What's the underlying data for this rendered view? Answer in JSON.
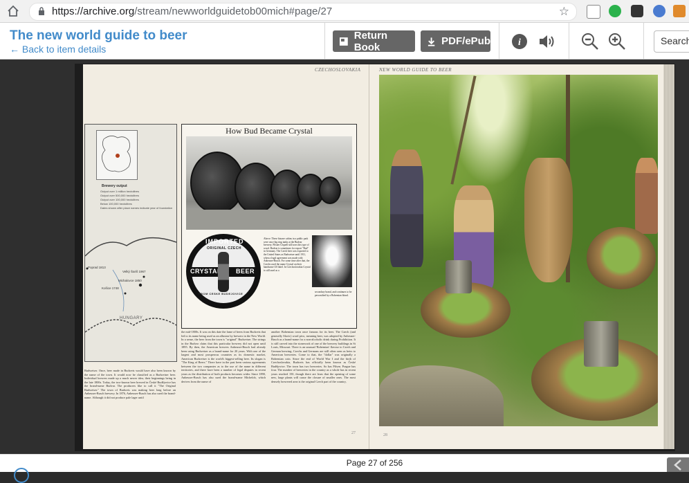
{
  "browser": {
    "url_host": "https://archive.org",
    "url_path": "/stream/newworldguidetob00mich#page/27"
  },
  "header": {
    "title": "The new world guide to beer",
    "back_link": "← Back to item details",
    "return_book": "Return Book",
    "pdf_epub": "PDF/ePub",
    "search_placeholder": "Search"
  },
  "book": {
    "left_running_head": "CZECHOSLOVAKIA",
    "right_running_head": "NEW WORLD GUIDE TO BEER",
    "feature_title": "How Bud Became Crystal",
    "label_top": "IMPORTED",
    "label_original": "ORIGINAL CZECH",
    "label_crystal": "CRYSTAL",
    "label_beer": "BEER",
    "label_bottom": "FROM CESKE BUDEJOVICE",
    "map_legend_title": "Brewery output",
    "map_legend": [
      "Output over 1 million hectolitres",
      "Output over 500,000 hectolitres",
      "Output over 100,000 hectolitres",
      "Below 100,000 hectolitres",
      "Dates shown after place names indicate year of foundation"
    ],
    "map_places": {
      "poprad": "Poprad 1813",
      "velky_saris": "Velký Šariš 1967",
      "michalovce": "Michalovce 1850",
      "kosice": "Košice 1748",
      "hungary": "HUNGARY"
    },
    "caption_1": "Above: These bizarre cabins in a public park were once big ring tanks at the Budvar brewery. Pilsner Urquell still uses this type of wood. Budvar is sometimes for export \"Bud\" in Germany. The Czech beer was exported to the United States as Budweiser until 1911, when a legal agreement was made with Anheuser-Busch. For some time after that, the Czechs used the name Crystal on their handsome US label. In Czechoslovakia Crystal is still used as a",
    "caption_2": "secondary brand, and continues to be personified by a Bohemian blond.",
    "col_left": "Budweiser. Once, beer made in Budweis would have also been known by the name of the town. It would now be classified as a Budweiser beer. Individual brewers made up a much newer idea, their beginnings being in the late 1800s. Today, the two-known beer brewed in České Budějovice has the brand-name Budvar. The producers like to call it \"The Original Budweiser.\" The town of Budweis was making beer long before an Anheuser-Busch brewery. In 1876, Anheuser-Busch has also used the brand-name. Although it did not produce pale lager until",
    "col_mid": "the mid-1800s. It was on this date the fame of beers from Budweis that led to its name being used as an allusion by brewers in the New World. In a sense, the beer from the town is \"original\" Budweiser. The strings in the Budvar claim that this particular brewery did not open until 1895. By then, the American brewers Anheuser-Busch had already been using Budweiser as a brand-name for 20 years. With one of the largest and most prosperous countries as its domestic market, American Budweiser is the world's biggest-selling beer. Its slogan is \"The King of Beers.\" There have in the past been various agreements between the two companies as to the use of the name in different territories, and there have been a number of legal disputes in recent years as the distribution of both products becomes wider. Since 1890, Anheuser-Busch has also used the brand-name Michelob, which derives from the name of",
    "col_right": "another Bohemian town once famous for its beer. The Czech (and generally Slavic) word pivo, meaning beer, was adopted by Anheuser-Busch as a brand-name for a non-alcoholic drink during Prohibition. It is still carved into the stonework of one of the brewery buildings in St Louis, Missouri. There is an unusual 'Bohemian' flavour to Czech and German brewing; Czechs and Germans are still often seen as heirs to American breweries. Come to that, the \"dollar\" was originally a Bohemian coin. Since the end of World War I and the birth of Czechoslovakia, Budweis has officially been known as České Budějovice. The town has two breweries. So has Pilsen. Prague has four. The number of breweries in the country as a whole has in recent years reached 150, though there are fears that the opening of some new, large plants will cause the closure of smaller ones. The most densely brewered area is the original Czech part of the country,",
    "folio_left": "27",
    "folio_right": "28"
  },
  "footer": {
    "page_indicator": "Page 27 of 256"
  }
}
